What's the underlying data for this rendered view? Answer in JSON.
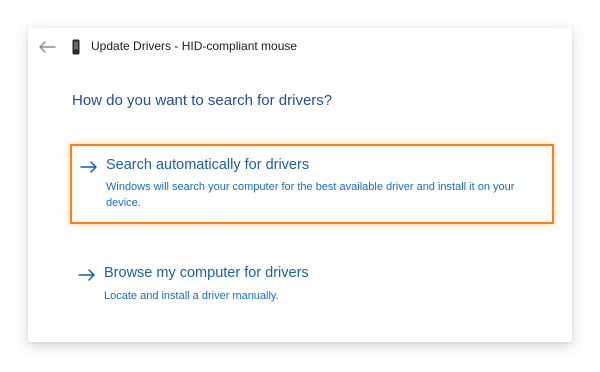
{
  "window": {
    "title": "Update Drivers - HID-compliant mouse"
  },
  "heading": "How do you want to search for drivers?",
  "options": [
    {
      "title": "Search automatically for drivers",
      "description": "Windows will search your computer for the best available driver and install it on your device.",
      "highlighted": true
    },
    {
      "title": "Browse my computer for drivers",
      "description": "Locate and install a driver manually.",
      "highlighted": false
    }
  ],
  "icons": {
    "back": "back-arrow-icon",
    "device": "device-icon",
    "option_arrow": "right-arrow-icon"
  },
  "colors": {
    "heading": "#1f4e9c",
    "link": "#1a5fa8",
    "description": "#1a6cc0",
    "highlight_border": "#f58220"
  }
}
